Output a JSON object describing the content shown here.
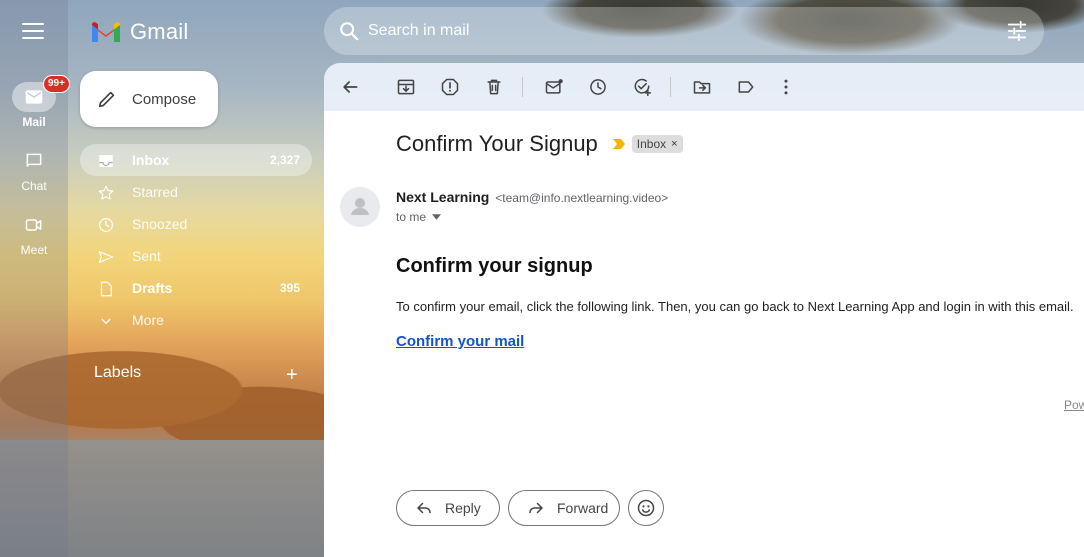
{
  "app": {
    "logo_text": "Gmail"
  },
  "rail": {
    "items": [
      {
        "label": "Mail",
        "badge": "99+"
      },
      {
        "label": "Chat"
      },
      {
        "label": "Meet"
      }
    ]
  },
  "search": {
    "placeholder": "Search in mail"
  },
  "compose": {
    "label": "Compose"
  },
  "nav": {
    "items": [
      {
        "label": "Inbox",
        "count": "2,327"
      },
      {
        "label": "Starred",
        "count": ""
      },
      {
        "label": "Snoozed",
        "count": ""
      },
      {
        "label": "Sent",
        "count": ""
      },
      {
        "label": "Drafts",
        "count": "395"
      },
      {
        "label": "More",
        "count": ""
      }
    ],
    "labels_heading": "Labels",
    "labels_add": "+"
  },
  "toolbar": {
    "icons": [
      "back-arrow-icon",
      "archive-icon",
      "report-spam-icon",
      "delete-icon",
      "mark-unread-icon",
      "snooze-icon",
      "add-task-icon",
      "move-to-icon",
      "label-icon",
      "more-vert-icon"
    ]
  },
  "email": {
    "subject": "Confirm Your Signup",
    "label_chip": "Inbox",
    "label_chip_close": "×",
    "sender_name": "Next Learning",
    "sender_email": "<team@info.nextlearning.video>",
    "to_line": "to me",
    "body_heading": "Confirm your signup",
    "body_text": "To confirm your email, click the following link. Then, you can go back to Next Learning App and login in with this email.",
    "body_link": "Confirm your mail",
    "footer_fragment": "Pow"
  },
  "actions": {
    "reply": "Reply",
    "forward": "Forward"
  },
  "colors": {
    "link": "#1155cc",
    "badge": "#d93025",
    "importance": "#f4b400"
  }
}
